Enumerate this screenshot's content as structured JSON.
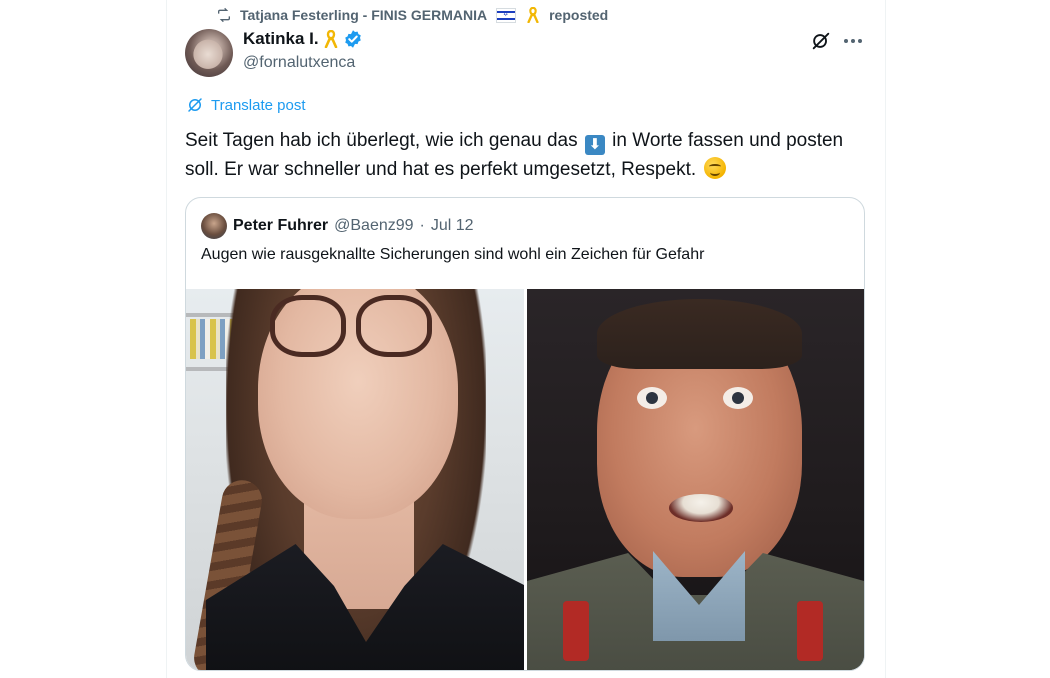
{
  "repost": {
    "reposter": "Tatjana Festerling - FINIS GERMANIA",
    "suffix": "reposted"
  },
  "post": {
    "author_name": "Katinka I.",
    "handle": "@fornalutxenca",
    "translate_label": "Translate post",
    "text_part1": "Seit Tagen hab ich überlegt, wie ich genau das",
    "text_part2": "in Worte fassen und posten soll. Er war schneller und hat es perfekt umgesetzt, Respekt.",
    "down_arrow_glyph": "⬇"
  },
  "quote": {
    "author_name": "Peter Fuhrer",
    "handle": "@Baenz99",
    "separator": "·",
    "date": "Jul 12",
    "text": "Augen wie rausgeknallte Sicherungen sind wohl ein Zeichen für Gefahr"
  },
  "icons": {
    "repost": "repost-icon",
    "verified": "verified-badge-icon",
    "grok": "grok-icon",
    "more": "more-icon",
    "translate": "translate-icon",
    "ribbon": "yellow-ribbon-icon"
  },
  "colors": {
    "accent": "#1d9bf0",
    "secondary_text": "#536471",
    "primary_text": "#0f1419",
    "border": "#cfd9de"
  }
}
